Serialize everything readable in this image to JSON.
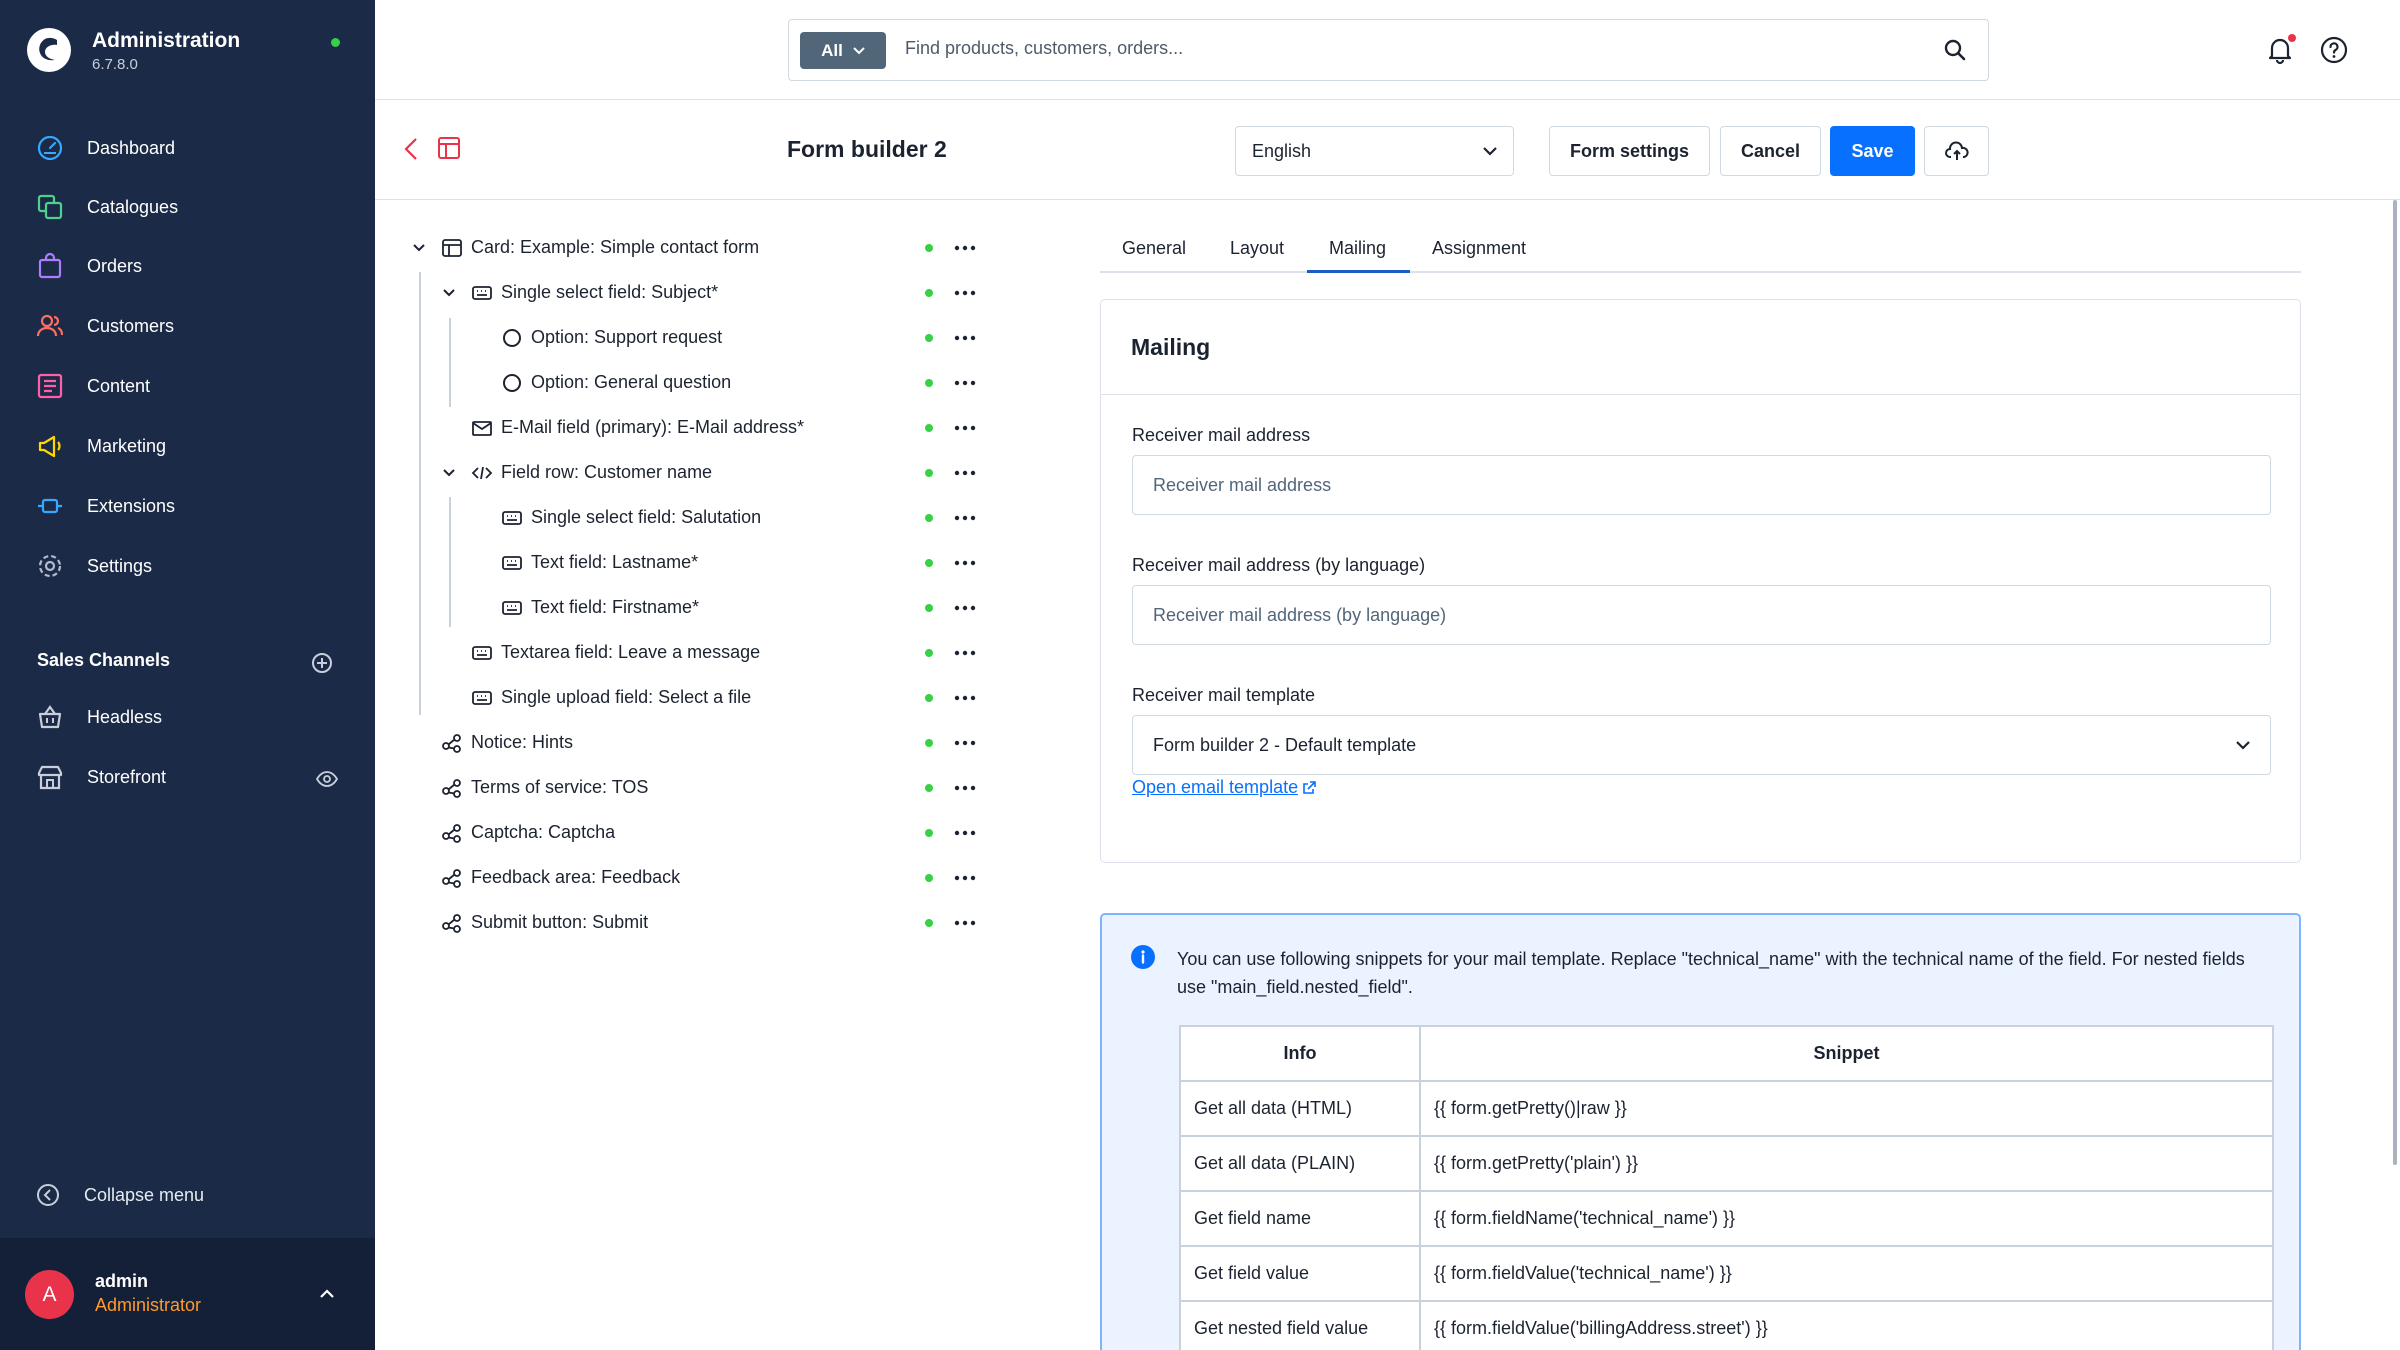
{
  "app": {
    "name": "Administration",
    "version": "6.7.8.0"
  },
  "nav": [
    {
      "label": "Dashboard",
      "icon": "dashboard-icon"
    },
    {
      "label": "Catalogues",
      "icon": "catalogues-icon"
    },
    {
      "label": "Orders",
      "icon": "orders-icon"
    },
    {
      "label": "Customers",
      "icon": "customers-icon"
    },
    {
      "label": "Content",
      "icon": "content-icon"
    },
    {
      "label": "Marketing",
      "icon": "marketing-icon"
    },
    {
      "label": "Extensions",
      "icon": "extensions-icon"
    },
    {
      "label": "Settings",
      "icon": "settings-icon"
    }
  ],
  "sales_channels": {
    "title": "Sales Channels",
    "items": [
      {
        "label": "Headless",
        "icon": "basket-icon"
      },
      {
        "label": "Storefront",
        "icon": "storefront-icon"
      }
    ]
  },
  "collapse_label": "Collapse menu",
  "user": {
    "initial": "A",
    "name": "admin",
    "role": "Administrator"
  },
  "search": {
    "type": "All",
    "placeholder": "Find products, customers, orders..."
  },
  "page": {
    "title": "Form builder 2",
    "language": "English",
    "buttons": {
      "form_settings": "Form settings",
      "cancel": "Cancel",
      "save": "Save"
    }
  },
  "tree": [
    {
      "label": "Card: Example: Simple contact form",
      "icon": "card-icon"
    },
    {
      "label": "Single select field: Subject*",
      "icon": "field-icon"
    },
    {
      "label": "Option: Support request",
      "icon": "option-icon"
    },
    {
      "label": "Option: General question",
      "icon": "option-icon"
    },
    {
      "label": "E-Mail field (primary): E-Mail address*",
      "icon": "mail-icon"
    },
    {
      "label": "Field row: Customer name",
      "icon": "code-icon"
    },
    {
      "label": "Single select field: Salutation",
      "icon": "field-icon"
    },
    {
      "label": "Text field: Lastname*",
      "icon": "field-icon"
    },
    {
      "label": "Text field: Firstname*",
      "icon": "field-icon"
    },
    {
      "label": "Textarea field: Leave a message",
      "icon": "field-icon"
    },
    {
      "label": "Single upload field: Select a file",
      "icon": "field-icon"
    },
    {
      "label": "Notice: Hints",
      "icon": "share-icon"
    },
    {
      "label": "Terms of service: TOS",
      "icon": "share-icon"
    },
    {
      "label": "Captcha: Captcha",
      "icon": "share-icon"
    },
    {
      "label": "Feedback area: Feedback",
      "icon": "share-icon"
    },
    {
      "label": "Submit button: Submit",
      "icon": "share-icon"
    }
  ],
  "tabs": [
    "General",
    "Layout",
    "Mailing",
    "Assignment"
  ],
  "mailing": {
    "title": "Mailing",
    "receiver_label": "Receiver mail address",
    "receiver_placeholder": "Receiver mail address",
    "receiver_lang_label": "Receiver mail address (by language)",
    "receiver_lang_placeholder": "Receiver mail address (by language)",
    "template_label": "Receiver mail template",
    "template_value": "Form builder 2 - Default template",
    "open_template_link": "Open email template"
  },
  "info": {
    "text": "You can use following snippets for your mail template. Replace \"technical_name\" with the technical name of the field. For nested fields use \"main_field.nested_field\".",
    "table": {
      "headers": [
        "Info",
        "Snippet"
      ],
      "rows": [
        [
          "Get all data (HTML)",
          "{{ form.getPretty()|raw }}"
        ],
        [
          "Get all data (PLAIN)",
          "{{ form.getPretty('plain') }}"
        ],
        [
          "Get field name",
          "{{ form.fieldName('technical_name') }}"
        ],
        [
          "Get field value",
          "{{ form.fieldValue('technical_name') }}"
        ],
        [
          "Get nested field value",
          "{{ form.fieldValue('billingAddress.street') }}"
        ]
      ]
    }
  },
  "colors": {
    "sidebar": "#1b2a46",
    "primary": "#0870ff",
    "status_active": "#37d046",
    "role": "#ff9a2b"
  }
}
